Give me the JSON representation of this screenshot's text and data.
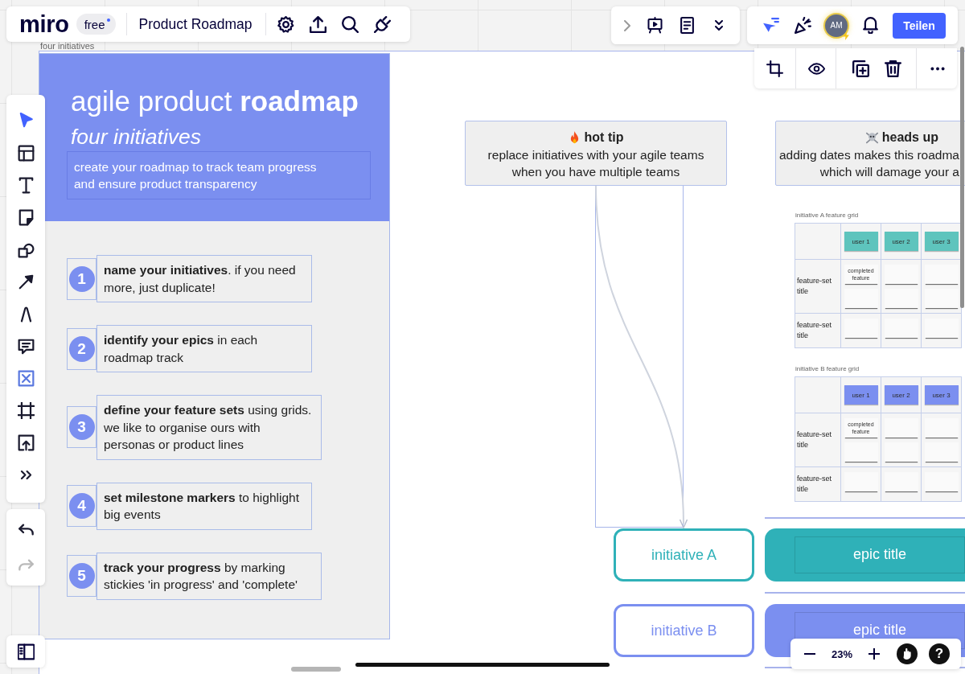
{
  "top_bar": {
    "logo": "miro",
    "plan_badge": "free",
    "board_title": "Product Roadmap"
  },
  "collaboration_bar": {
    "avatar_initials": "AM",
    "share_button": "Teilen"
  },
  "left_toolbar": {
    "tools": [
      {
        "selected": true
      },
      {
        "selected": false
      },
      {
        "selected": false
      },
      {
        "selected": false
      },
      {
        "selected": false
      },
      {
        "selected": false
      },
      {
        "selected": false
      },
      {
        "selected": false
      },
      {
        "selected": false
      },
      {
        "selected": false
      },
      {
        "selected": false
      },
      {
        "selected": false
      }
    ]
  },
  "history": [
    {
      "disabled": false
    },
    {
      "disabled": true
    }
  ],
  "frame_label": "four initiatives",
  "intro": {
    "title": "agile product **roadmap**",
    "subtitle": "four initiatives",
    "description": [
      "create your roadmap to track team progress",
      "and ensure product transparency"
    ]
  },
  "steps": [
    {
      "number": "1",
      "lines": [
        "**name your initiatives**. if you need",
        "more, just duplicate!"
      ]
    },
    {
      "number": "2",
      "lines": [
        "**identify your epics** in each",
        "roadmap track"
      ]
    },
    {
      "number": "3",
      "lines": [
        "**define your feature sets** using grids.",
        "we like to organise ours with",
        "personas or product lines"
      ]
    },
    {
      "number": "4",
      "lines": [
        "**set milestone markers** to highlight",
        "big events"
      ]
    },
    {
      "number": "5",
      "lines": [
        "**track your progress** by marking",
        "stickies 'in progress' and 'complete'"
      ]
    }
  ],
  "notes": [
    {
      "kind": "tip",
      "heading": "hot tip",
      "lines": [
        "replace initiatives with your agile teams",
        "when you have multiple teams"
      ]
    },
    {
      "kind": "warning",
      "heading": "heads up",
      "lines": [
        "adding dates makes this roadma",
        "which will damage your a"
      ]
    }
  ],
  "feature_grids": [
    {
      "title": "initiative A feature grid",
      "color": "#5ec4bd",
      "users": [
        "user 1",
        "user 2",
        "user 3"
      ],
      "rows": [
        {
          "label": "feature-set title",
          "cells": [
            {
              "stickies": [
                {
                  "kind": "text",
                  "text": "completed feature"
                },
                {
                  "kind": "blank"
                }
              ]
            },
            {
              "stickies": [
                {
                  "kind": "blank"
                },
                {
                  "kind": "blank"
                }
              ]
            },
            {
              "stickies": [
                {
                  "kind": "blank"
                },
                {
                  "kind": "blank"
                }
              ]
            }
          ]
        },
        {
          "label": "feature-set title",
          "cells": [
            {
              "stickies": [
                {
                  "kind": "blank"
                }
              ]
            },
            {
              "stickies": [
                {
                  "kind": "blank"
                }
              ]
            },
            {
              "stickies": [
                {
                  "kind": "blank"
                }
              ]
            }
          ]
        }
      ]
    },
    {
      "title": "initiative B feature grid",
      "color": "#7b8ff0",
      "users": [
        "user 1",
        "user 2",
        "user 3"
      ],
      "rows": [
        {
          "label": "feature-set title",
          "cells": [
            {
              "stickies": [
                {
                  "kind": "text",
                  "text": "completed feature"
                },
                {
                  "kind": "blank"
                }
              ]
            },
            {
              "stickies": [
                {
                  "kind": "blank"
                },
                {
                  "kind": "blank"
                }
              ]
            },
            {
              "stickies": [
                {
                  "kind": "blank"
                },
                {
                  "kind": "blank"
                }
              ]
            }
          ]
        },
        {
          "label": "feature-set title",
          "cells": [
            {
              "stickies": [
                {
                  "kind": "blank"
                }
              ]
            },
            {
              "stickies": [
                {
                  "kind": "blank"
                }
              ]
            },
            {
              "stickies": [
                {
                  "kind": "blank"
                }
              ]
            }
          ]
        }
      ]
    }
  ],
  "lanes": [
    {
      "initiative": "initiative A",
      "epic": "epic title",
      "color": "#2fb1b8"
    },
    {
      "initiative": "initiative B",
      "epic": "epic title",
      "color": "#7b8ff0"
    }
  ],
  "zoom": {
    "level_text": "23%",
    "help": "?"
  }
}
